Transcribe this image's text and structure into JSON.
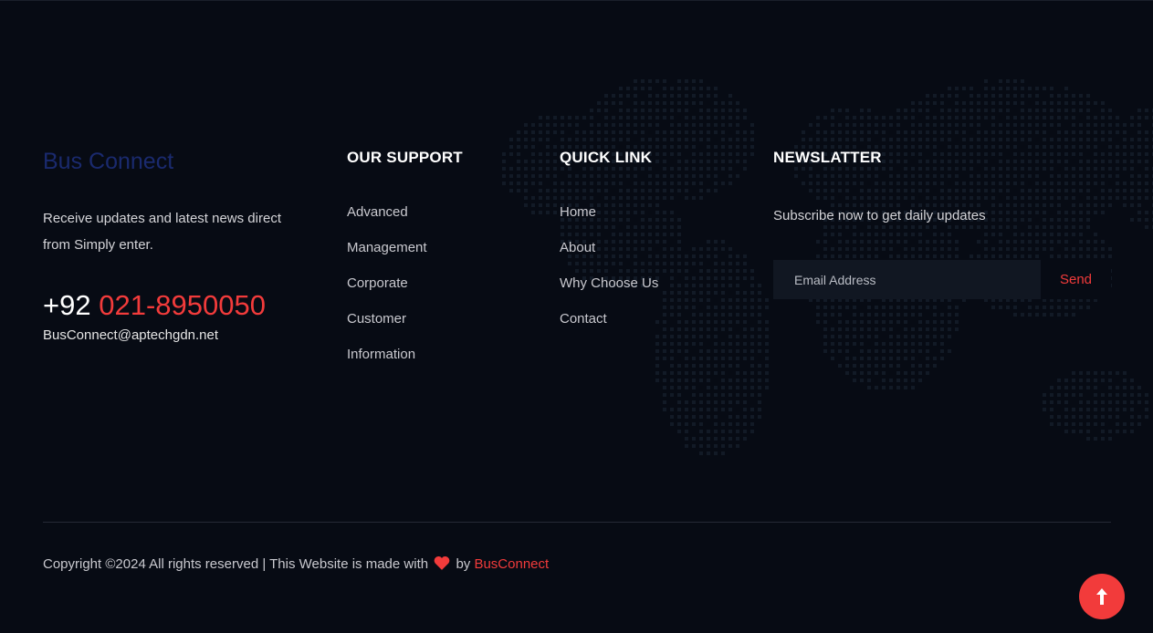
{
  "brand": {
    "title": "Bus Connect",
    "description": "Receive updates and latest news direct from Simply enter.",
    "phone_prefix": "+92",
    "phone_number": "021-8950050",
    "email": "BusConnect@aptechgdn.net"
  },
  "support": {
    "heading": "OUR SUPPORT",
    "items": [
      "Advanced",
      "Management",
      "Corporate",
      "Customer",
      "Information"
    ]
  },
  "quick_link": {
    "heading": "QUICK LINK",
    "items": [
      "Home",
      "About",
      "Why Choose Us",
      "Contact"
    ]
  },
  "newsletter": {
    "heading": "NEWSLATTER",
    "text": "Subscribe now to get daily updates",
    "email_placeholder": "Email Address",
    "email_value": "",
    "send_label": "Send"
  },
  "copyright": {
    "text": "Copyright ©2024 All rights reserved | This Website is made with",
    "by": "by",
    "brand": "BusConnect"
  },
  "icons": {
    "heart": "heart-icon",
    "back_to_top": "arrow-up-icon",
    "background": "world-map-dots"
  },
  "colors": {
    "background": "#070b14",
    "accent": "#f23b3b",
    "brand_title": "#1a2a6e",
    "input_bg": "#111722"
  }
}
